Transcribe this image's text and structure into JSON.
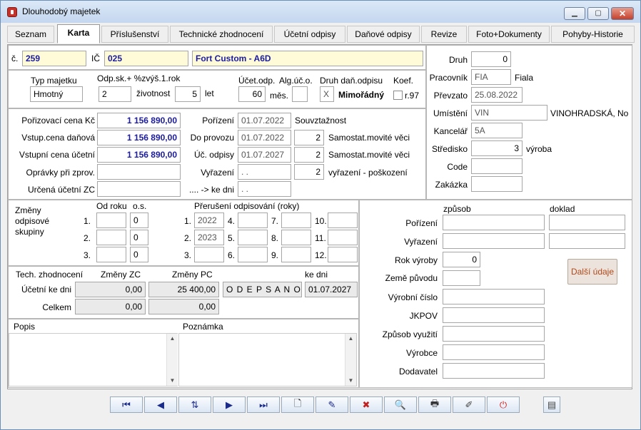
{
  "window": {
    "title": "Dlouhodobý majetek"
  },
  "tabs": [
    {
      "label": "Seznam"
    },
    {
      "label": "Karta"
    },
    {
      "label": "Příslušenství"
    },
    {
      "label": "Technické zhodnocení"
    },
    {
      "label": "Účetní odpisy"
    },
    {
      "label": "Daňové odpisy"
    },
    {
      "label": "Revize"
    },
    {
      "label": "Foto+Dokumenty"
    },
    {
      "label": "Pohyby-Historie"
    }
  ],
  "header": {
    "c_label": "č.",
    "c_value": "259",
    "ic_label": "IČ",
    "ic_value": "025",
    "name_value": "Fort Custom - A6D"
  },
  "typ": {
    "typ_label": "Typ majetku",
    "typ_value": "Hmotný",
    "odpsk_label": "Odp.sk.+ %zvýš.1.rok",
    "odpsk_value": "2",
    "zivotnost_label": "životnost",
    "zivotnost_value": "5",
    "let_label": "let",
    "ucetodp_label": "Účet.odp.",
    "ucetodp_value": "60",
    "mes_label": "měs.",
    "alguc_label": "Alg.úč.o.",
    "alguc_value": "",
    "druhdan_label": "Druh daň.odpisu",
    "druhdan_code": "X",
    "druhdan_text": "Mimořádný",
    "koef_label": "Koef.",
    "r97_label": "r.97"
  },
  "ceny": {
    "porizovaci_label": "Pořizovací cena Kč",
    "porizovaci_value": "1 156 890,00",
    "vstup_danova_label": "Vstup.cena daňová",
    "vstup_danova_value": "1 156 890,00",
    "vstupni_ucetni_label": "Vstupní cena účetní",
    "vstupni_ucetni_value": "1 156 890,00",
    "opravky_label": "Oprávky při zprov.",
    "opravky_value": "",
    "urcena_label": "Určená účetní ZC",
    "urcena_value": "",
    "porizeni_label": "Pořízení",
    "porizeni_value": "01.07.2022",
    "souvztaznost_label": "Souvztažnost",
    "doprovozu_label": "Do provozu",
    "doprovozu_value": "01.07.2022",
    "doprovozu_num": "2",
    "doprovozu_text": "Samostat.movité věci",
    "ucodpisy_label": "Úč. odpisy",
    "ucodpisy_value": "01.07.2027",
    "ucodpisy_num": "2",
    "ucodpisy_text": "Samostat.movité věci",
    "vyrazeni_label": "Vyřazení",
    "vyrazeni_value": " .  .",
    "vyrazeni_num": "2",
    "vyrazeni_text": "vyřazení - poškození",
    "kedni_label": ".... -> ke dni",
    "kedni_value": " .  ."
  },
  "zmeny": {
    "label": "Změny odpisové skupiny",
    "odroku_label": "Od roku",
    "os_label": "o.s.",
    "rows": [
      {
        "n": "1.",
        "rok": "",
        "os": "0"
      },
      {
        "n": "2.",
        "rok": "",
        "os": "0"
      },
      {
        "n": "3.",
        "rok": "",
        "os": "0"
      }
    ],
    "preruseni_label": "Přerušení odpisování (roky)",
    "preruseni": [
      {
        "n": "1.",
        "v": "2022"
      },
      {
        "n": "2.",
        "v": "2023"
      },
      {
        "n": "3.",
        "v": ""
      },
      {
        "n": "4.",
        "v": ""
      },
      {
        "n": "5.",
        "v": ""
      },
      {
        "n": "6.",
        "v": ""
      },
      {
        "n": "7.",
        "v": ""
      },
      {
        "n": "8.",
        "v": ""
      },
      {
        "n": "9.",
        "v": ""
      },
      {
        "n": "10.",
        "v": ""
      },
      {
        "n": "11.",
        "v": ""
      },
      {
        "n": "12.",
        "v": ""
      }
    ]
  },
  "tech": {
    "label": "Tech. zhodnocení",
    "zmeny_zc_label": "Změny ZC",
    "zmeny_pc_label": "Změny PC",
    "kedni_label": "ke dni",
    "ucetni_label": "Účetní ke dni",
    "ucetni_zc": "0,00",
    "ucetni_pc": "25 400,00",
    "status": "O D E P S A N O",
    "kedni_value": "01.07.2027",
    "celkem_label": "Celkem",
    "celkem_zc": "0,00",
    "celkem_pc": "0,00"
  },
  "notes": {
    "popis_label": "Popis",
    "poznamka_label": "Poznámka",
    "popis_value": "",
    "poznamka_value": ""
  },
  "right": {
    "druh_label": "Druh",
    "druh_value": "0",
    "pracovnik_label": "Pracovník",
    "pracovnik_value": "FIA",
    "pracovnik_name": "Fiala",
    "prevzato_label": "Převzato",
    "prevzato_value": "25.08.2022",
    "umisteni_label": "Umístění",
    "umisteni_value": "VIN",
    "umisteni_name": "VINOHRADSKÁ, No",
    "kancelar_label": "Kancelář",
    "kancelar_value": "5A",
    "stredisko_label": "Středisko",
    "stredisko_value": "3",
    "stredisko_name": "výroba",
    "code_label": "Code",
    "code_value": "",
    "zakazka_label": "Zakázka",
    "zakazka_value": ""
  },
  "lower_right": {
    "zpusob_label": "způsob",
    "doklad_label": "doklad",
    "porizeni_label": "Pořízení",
    "vyrazeni_label": "Vyřazení",
    "rokvyroby_label": "Rok výroby",
    "rokvyroby_value": "0",
    "zeme_label": "Země původu",
    "vyrobni_label": "Výrobní číslo",
    "jkpov_label": "JKPOV",
    "zpusobvyuziti_label": "Způsob využití",
    "vyrobce_label": "Výrobce",
    "dodavatel_label": "Dodavatel",
    "dalsi_label": "Další údaje"
  },
  "toolbar": {
    "first": "⏮",
    "prev": "◀",
    "sort": "⇅",
    "next": "▶",
    "last": "⏭",
    "new": "🗋",
    "edit": "✎",
    "delete": "✖",
    "search": "🔍",
    "print": "🖶",
    "tools": "✐",
    "exit": "⏻",
    "extra": "▤"
  }
}
